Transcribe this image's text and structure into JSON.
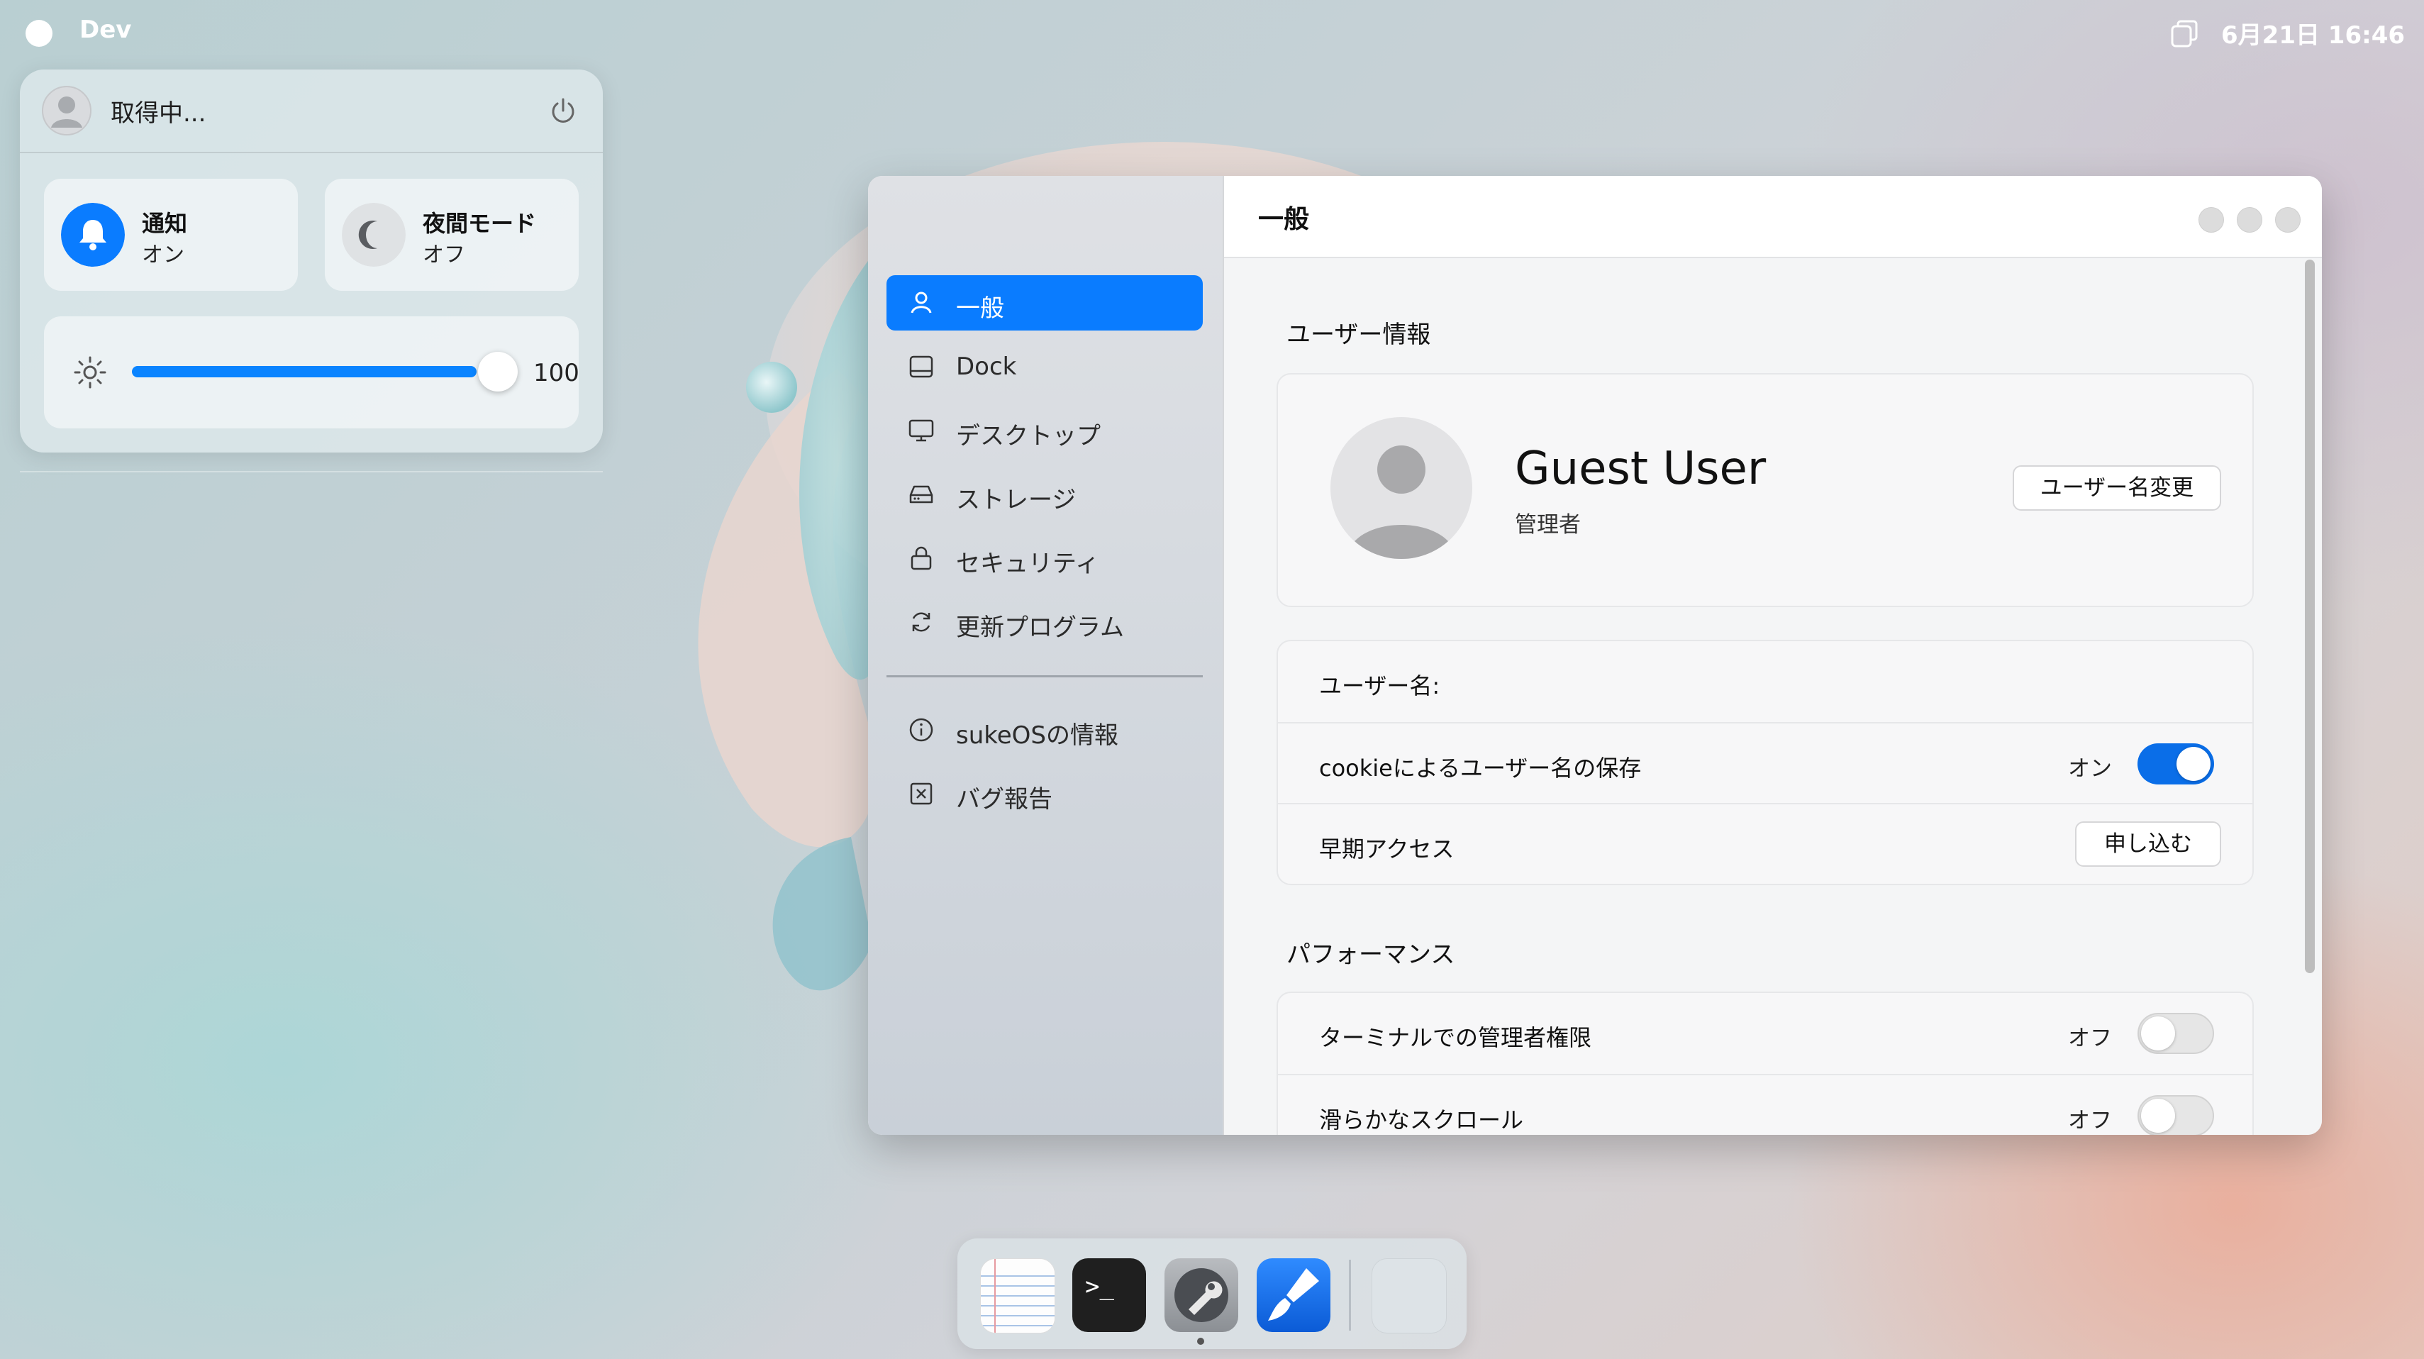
{
  "topbar": {
    "app_name": "Dev",
    "clock": "6月21日 16:46"
  },
  "control_center": {
    "user_name": "取得中...",
    "notifications": {
      "label": "通知",
      "state": "オン"
    },
    "night_mode": {
      "label": "夜間モード",
      "state": "オフ"
    },
    "brightness": {
      "value": "100",
      "level_percent": 100
    }
  },
  "window": {
    "title": "一般",
    "sidebar": {
      "items": [
        {
          "label": "一般",
          "icon": "person-icon",
          "active": true
        },
        {
          "label": "Dock",
          "icon": "dock-icon"
        },
        {
          "label": "デスクトップ",
          "icon": "monitor-icon"
        },
        {
          "label": "ストレージ",
          "icon": "drive-icon"
        },
        {
          "label": "セキュリティ",
          "icon": "lock-icon"
        },
        {
          "label": "更新プログラム",
          "icon": "refresh-icon"
        }
      ],
      "footer_items": [
        {
          "label": "sukeOSの情報",
          "icon": "info-icon"
        },
        {
          "label": "バグ報告",
          "icon": "bug-report-icon"
        }
      ]
    },
    "user_info": {
      "section_title": "ユーザー情報",
      "display_name": "Guest User",
      "role": "管理者",
      "change_name_button": "ユーザー名変更"
    },
    "settings": {
      "username_label": "ユーザー名:",
      "cookie_save": {
        "label": "cookieによるユーザー名の保存",
        "state": "オン",
        "enabled": true
      },
      "early_access": {
        "label": "早期アクセス",
        "button": "申し込む"
      }
    },
    "performance": {
      "section_title": "パフォーマンス",
      "terminal_admin": {
        "label": "ターミナルでの管理者権限",
        "state": "オフ",
        "enabled": false
      },
      "smooth_scroll": {
        "label": "滑らかなスクロール",
        "state": "オフ",
        "enabled": false
      }
    }
  },
  "dock": {
    "apps": [
      {
        "name": "notes",
        "icon": "notepad-icon"
      },
      {
        "name": "terminal",
        "icon": "terminal-icon",
        "glyph": ">_"
      },
      {
        "name": "settings",
        "icon": "wrench-icon",
        "running": true
      },
      {
        "name": "paint",
        "icon": "paintbrush-icon"
      },
      {
        "name": "placeholder",
        "icon": "empty-app-icon"
      }
    ]
  },
  "colors": {
    "accent": "#0a7cff",
    "toggle_on": "#0a6ee8"
  }
}
